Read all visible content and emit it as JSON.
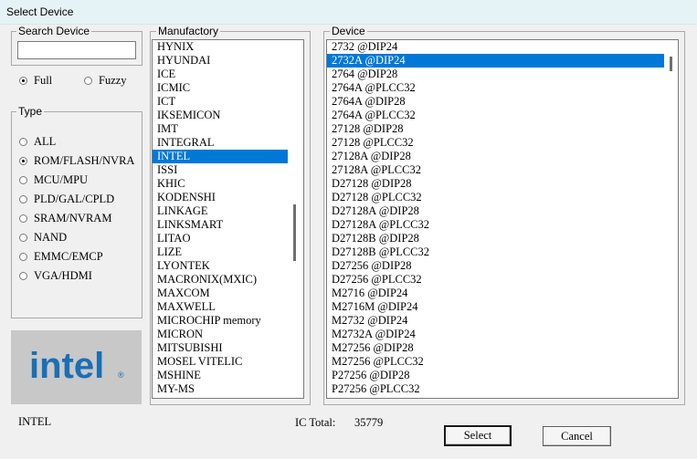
{
  "window": {
    "title": "Select Device"
  },
  "search": {
    "legend": "Search Device",
    "value": "",
    "mode_full": "Full",
    "mode_fuzzy": "Fuzzy"
  },
  "type": {
    "legend": "Type",
    "options": [
      "ALL",
      "ROM/FLASH/NVRA",
      "MCU/MPU",
      "PLD/GAL/CPLD",
      "SRAM/NVRAM",
      "NAND",
      "EMMC/EMCP",
      "VGA/HDMI"
    ],
    "selected": "ROM/FLASH/NVRA"
  },
  "logo": {
    "text": "intel",
    "mark": "®",
    "color": "#1a6fb5"
  },
  "manufactory": {
    "legend": "Manufactory",
    "items": [
      "HYNIX",
      "HYUNDAI",
      "ICE",
      "ICMIC",
      "ICT",
      "IKSEMICON",
      "IMT",
      "INTEGRAL",
      "INTEL",
      "ISSI",
      "KHIC",
      "KODENSHI",
      "LINKAGE",
      "LINKSMART",
      "LITAO",
      "LIZE",
      "LYONTEK",
      "MACRONIX(MXIC)",
      "MAXCOM",
      "MAXWELL",
      "MICROCHIP memory",
      "MICRON",
      "MITSUBISHI",
      "MOSEL VITELIC",
      "MSHINE",
      "MY-MS"
    ],
    "selected": "INTEL",
    "scroll_position": 0.55
  },
  "device": {
    "legend": "Device",
    "items": [
      "2732  @DIP24",
      "2732A  @DIP24",
      "2764  @DIP28",
      "2764A  @PLCC32",
      "2764A  @DIP28",
      "2764A  @PLCC32",
      "27128  @DIP28",
      "27128  @PLCC32",
      "27128A  @DIP28",
      "27128A  @PLCC32",
      "D27128  @DIP28",
      "D27128  @PLCC32",
      "D27128A  @DIP28",
      "D27128A  @PLCC32",
      "D27128B  @DIP28",
      "D27128B  @PLCC32",
      "D27256  @DIP28",
      "D27256  @PLCC32",
      "M2716  @DIP24",
      "M2716M  @DIP24",
      "M2732  @DIP24",
      "M2732A  @DIP24",
      "M27256  @DIP28",
      "M27256  @PLCC32",
      "P27256  @DIP28",
      "P27256  @PLCC32"
    ],
    "selected": "2732A  @DIP24",
    "scroll_position": 0.0
  },
  "footer": {
    "selected_manufacturer": "INTEL",
    "ic_total_label": "IC Total:",
    "ic_total_value": "35779",
    "select_label": "Select",
    "cancel_label": "Cancel"
  },
  "colors": {
    "selection": "#0078d7",
    "background": "#f0f0f0"
  }
}
